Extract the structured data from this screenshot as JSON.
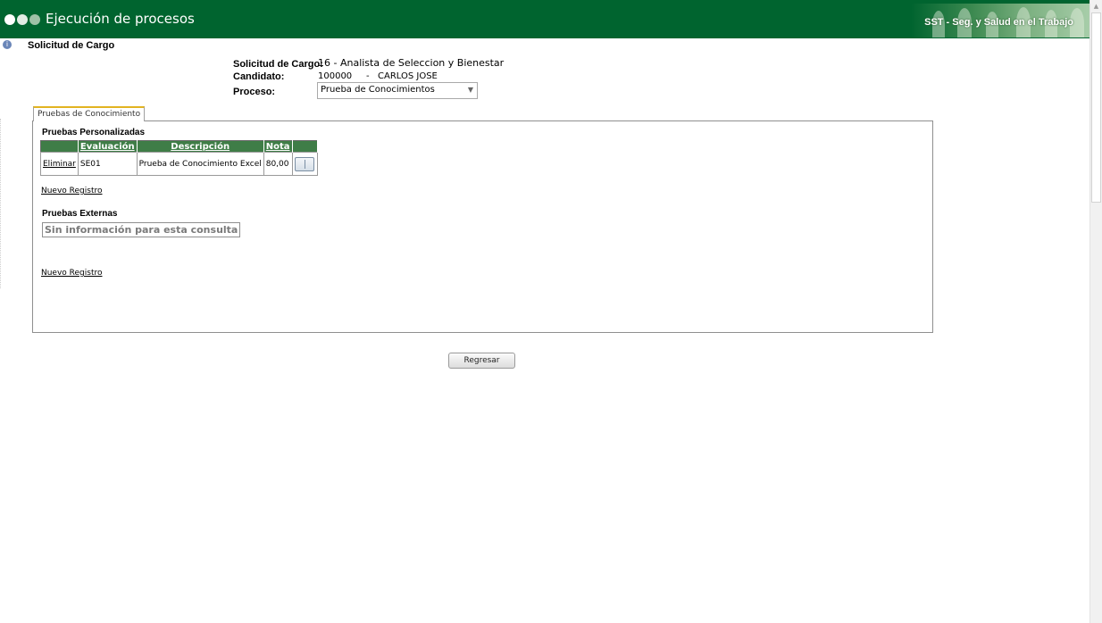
{
  "header": {
    "title": "Ejecución de procesos",
    "brand": "SST - Seg. y Salud en el Trabajo",
    "dots_icon": "three-dots-icon"
  },
  "page": {
    "title": "Solicitud de Cargo",
    "title_icon": "info-icon"
  },
  "form": {
    "cargo_label": "Solicitud de Cargo:",
    "cargo_value": "16 - Analista de Seleccion y Bienestar",
    "candidato_label": "Candidato:",
    "candidato_code": "100000",
    "candidato_sep": "-",
    "candidato_name": "CARLOS JOSE",
    "proceso_label": "Proceso:",
    "proceso_selected": "Prueba de Conocimientos"
  },
  "tabs": [
    {
      "label": "Pruebas de Conocimiento",
      "active": true
    }
  ],
  "pruebas_personalizadas": {
    "title": "Pruebas Personalizadas",
    "columns": [
      "",
      "Evaluación",
      "Descripción",
      "Nota",
      ""
    ],
    "rows": [
      {
        "action": "Eliminar",
        "evaluacion": "SE01",
        "descripcion": "Prueba de Conocimiento Excel",
        "nota": "80,00",
        "button_icon": "book-icon"
      }
    ],
    "new_link": "Nuevo Registro"
  },
  "pruebas_externas": {
    "title": "Pruebas Externas",
    "empty_message": "Sin información para esta consulta",
    "new_link": "Nuevo Registro"
  },
  "actions": {
    "back_label": "Regresar"
  },
  "colors": {
    "header_bg": "#00642f",
    "table_header_bg": "#3f7d47",
    "tab_accent": "#e2b321"
  }
}
